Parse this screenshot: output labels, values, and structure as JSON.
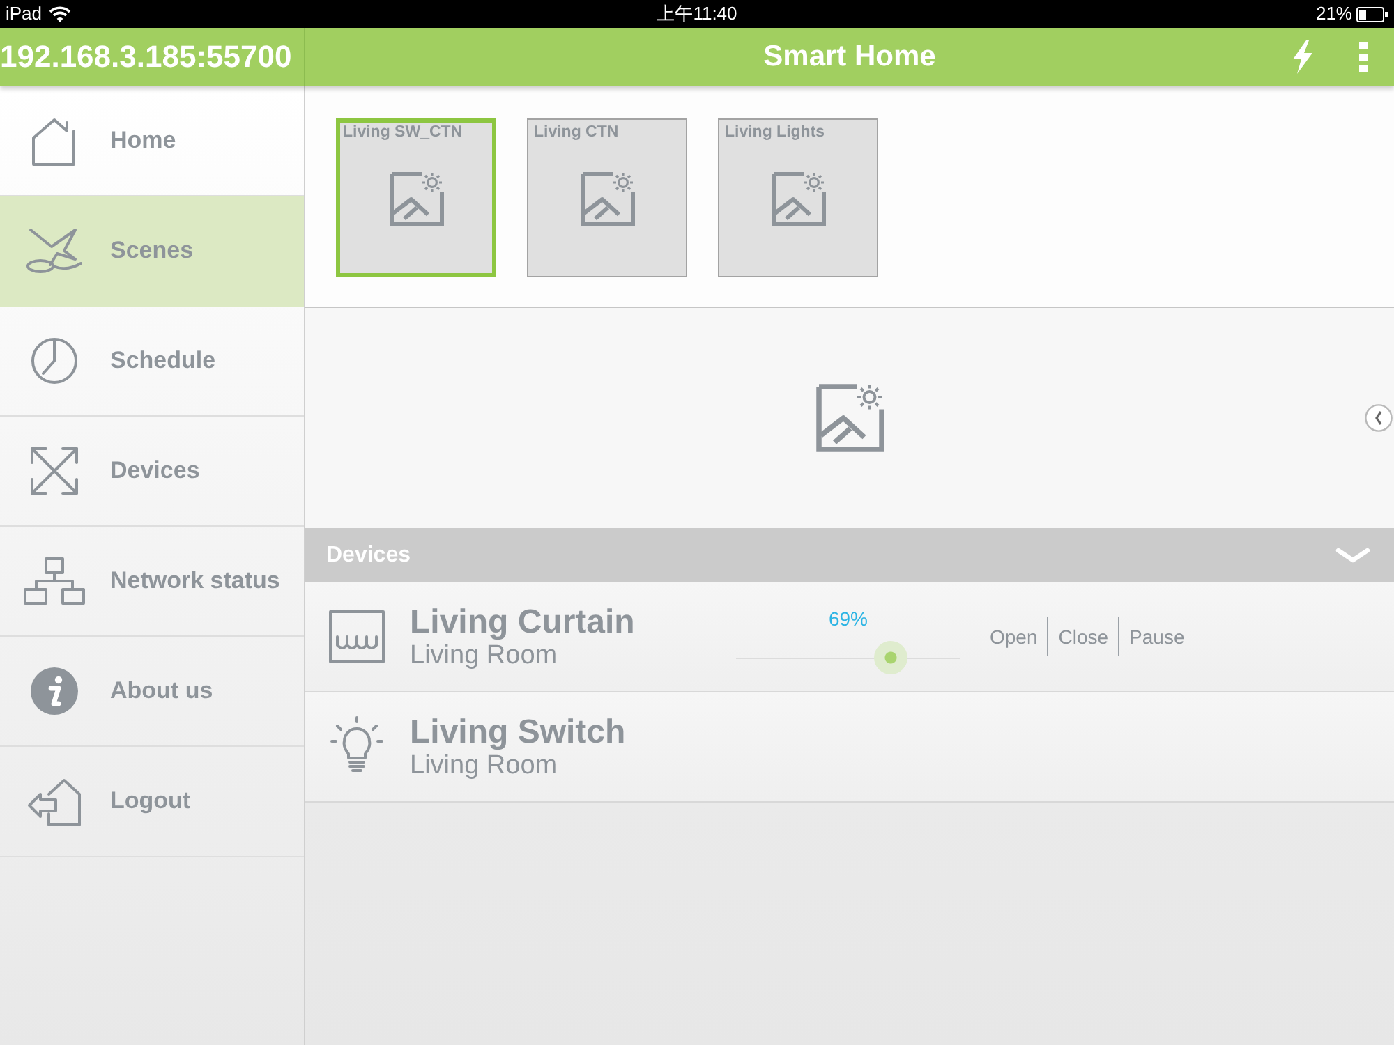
{
  "status_bar": {
    "carrier": "iPad",
    "time": "上午11:40",
    "battery": "21%"
  },
  "header": {
    "address": "192.168.3.185:55700",
    "title": "Smart Home"
  },
  "sidebar": {
    "items": [
      {
        "label": "Home",
        "selected": false
      },
      {
        "label": "Scenes",
        "selected": true
      },
      {
        "label": "Schedule",
        "selected": false
      },
      {
        "label": "Devices",
        "selected": false
      },
      {
        "label": "Network status",
        "selected": false
      },
      {
        "label": "About us",
        "selected": false
      },
      {
        "label": "Logout",
        "selected": false
      }
    ]
  },
  "scenes": [
    {
      "label": "Living SW_CTN",
      "selected": true
    },
    {
      "label": "Living CTN",
      "selected": false
    },
    {
      "label": "Living Lights",
      "selected": false
    }
  ],
  "devices_panel": {
    "title": "Devices",
    "expanded": true,
    "devices": [
      {
        "kind": "curtain",
        "name": "Living Curtain",
        "room": "Living Room",
        "reading": "69%",
        "level": 0.69,
        "actions": [
          "Open",
          "Close",
          "Pause"
        ]
      },
      {
        "kind": "switch",
        "name": "Living Switch",
        "room": "Living Room"
      }
    ]
  }
}
